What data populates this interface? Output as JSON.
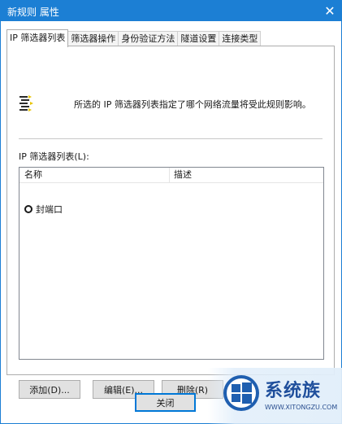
{
  "window": {
    "title": "新规则 属性",
    "close_glyph": "✕"
  },
  "tabs": [
    {
      "label": "IP 筛选器列表",
      "active": true
    },
    {
      "label": "筛选器操作",
      "active": false
    },
    {
      "label": "身份验证方法",
      "active": false
    },
    {
      "label": "隧道设置",
      "active": false
    },
    {
      "label": "连接类型",
      "active": false
    }
  ],
  "panel": {
    "description": "所选的 IP 筛选器列表指定了哪个网络流量将受此规则影响。",
    "list_label": "IP 筛选器列表(L):",
    "columns": {
      "name": "名称",
      "desc": "描述"
    },
    "rows": [
      {
        "name": "封端口",
        "selected": false
      }
    ]
  },
  "buttons": {
    "add": "添加(D)...",
    "edit": "编辑(E)...",
    "delete": "删除(R)",
    "close": "关闭"
  },
  "watermark": {
    "text": "系统族",
    "url": "WWW.XITONGZU.COM"
  },
  "colors": {
    "titlebar": "#1c7fd4",
    "watermark_text": "#1f4f9c"
  }
}
